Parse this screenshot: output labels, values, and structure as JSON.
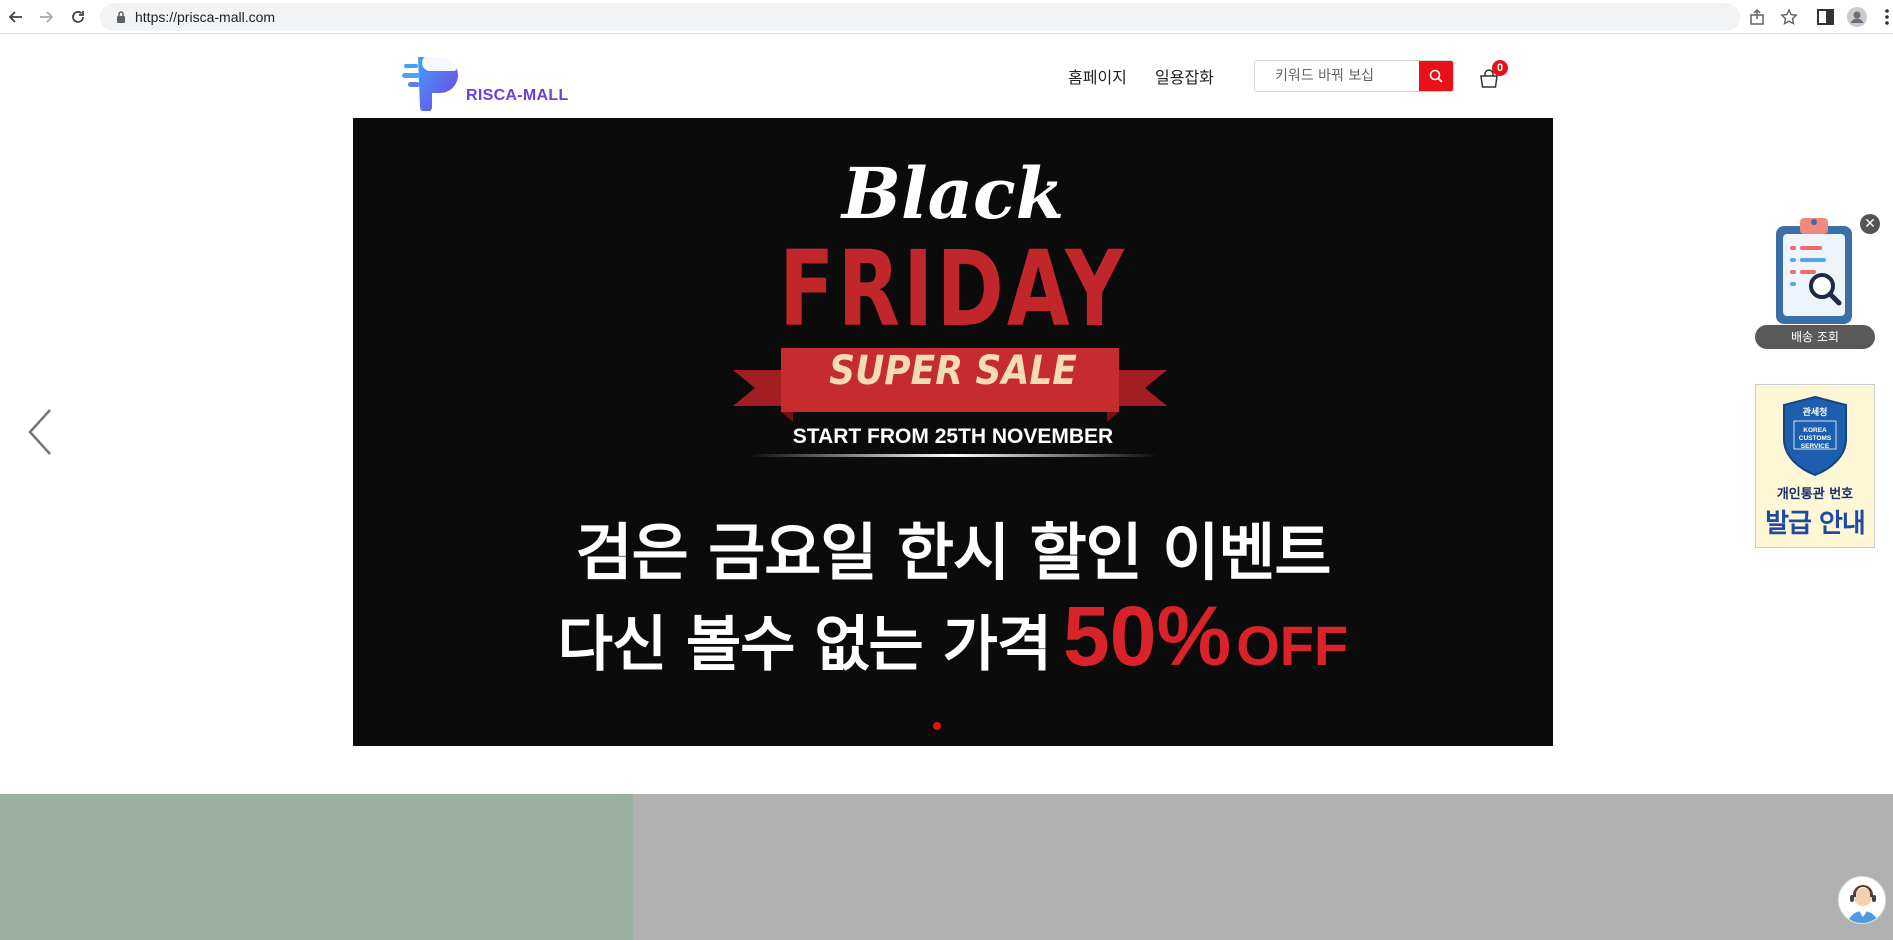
{
  "browser": {
    "url": "https://prisca-mall.com"
  },
  "header": {
    "logo_text": "RISCA-MALL",
    "nav": [
      "홈페이지",
      "일용잡화"
    ],
    "search_placeholder": "키워드 바꿔 보십",
    "cart_count": "0"
  },
  "banner": {
    "title_black": "Black",
    "title_friday": "FRIDAY",
    "super_sale": "SUPER SALE",
    "start": "START FROM 25TH NOVEMBER",
    "line1": "검은 금요일 한시 할인 이벤트",
    "line2": "다신 볼수 없는 가격",
    "discount": "50%",
    "off": "OFF",
    "active_slide": 1,
    "slide_count": 1
  },
  "widgets": {
    "delivery_label": "배송 조회",
    "close_symbol": "✕",
    "customs_badge": "관세청",
    "customs_en": "KOREA CUSTOMS SERVICE",
    "customs_line1": "개인통관 번호",
    "customs_line2": "발급 안내"
  },
  "colors": {
    "accent_red": "#e8111a",
    "brand_purple": "#6b3de0",
    "banner_bg": "#0b0b0b",
    "friday_red": "#c0262a",
    "block_green": "#9bb0a0",
    "block_gray": "#b1b1b1"
  },
  "icons": {
    "back": "arrow-left-icon",
    "forward": "arrow-right-icon",
    "reload": "reload-icon",
    "lock": "lock-icon",
    "share": "share-icon",
    "bookmark": "star-icon",
    "sidepanel": "side-panel-icon",
    "profile": "profile-icon",
    "menu": "kebab-menu-icon",
    "search": "search-icon",
    "cart": "cart-icon",
    "prev": "chevron-left-icon",
    "delivery": "clipboard-search-icon",
    "chat": "chat-agent-icon"
  }
}
